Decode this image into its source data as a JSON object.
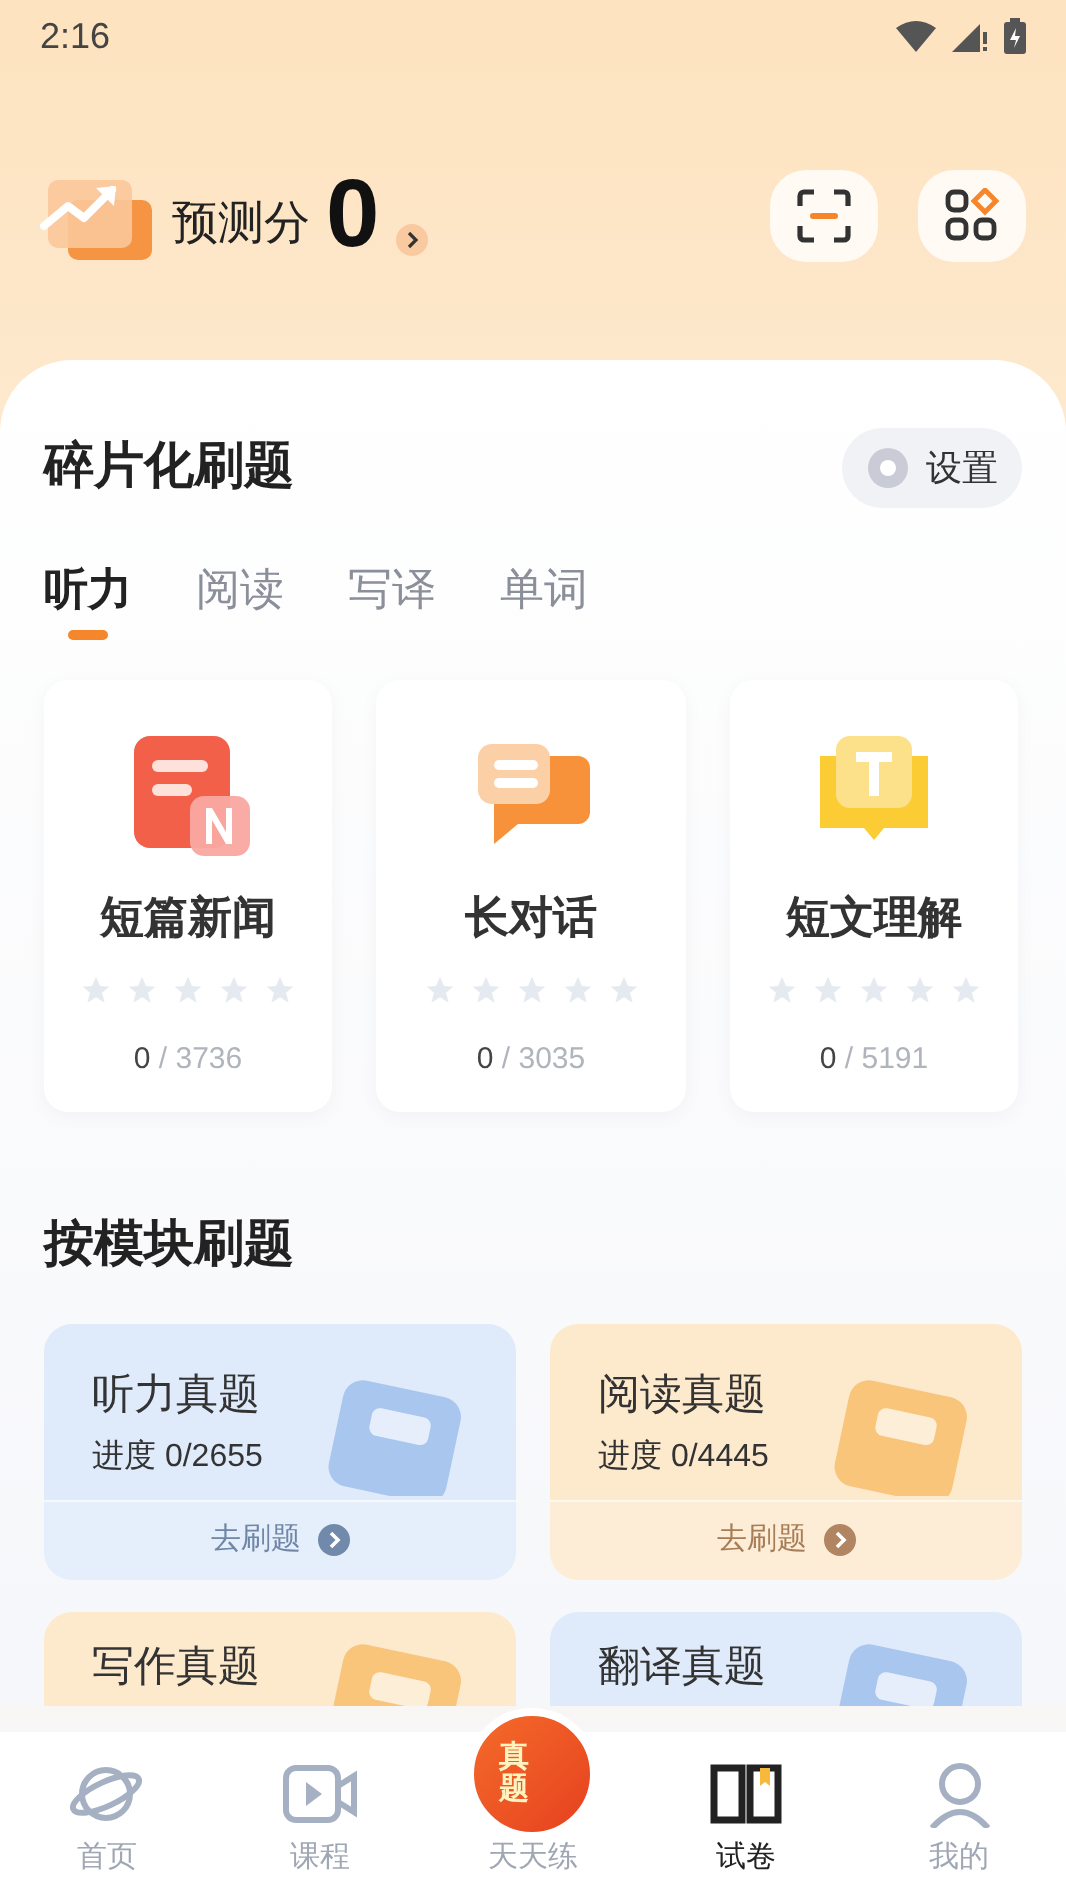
{
  "status_bar": {
    "time": "2:16"
  },
  "header": {
    "score_label": "预测分",
    "score": "0"
  },
  "fragment_section": {
    "title": "碎片化刷题",
    "settings_button": "设置",
    "tabs": [
      {
        "label": "听力",
        "selected": true
      },
      {
        "label": "阅读",
        "selected": false
      },
      {
        "label": "写译",
        "selected": false
      },
      {
        "label": "单词",
        "selected": false
      }
    ],
    "cards": [
      {
        "kind": "news",
        "title": "短篇新闻",
        "stars": 0,
        "done": "0",
        "total": "/ 3736"
      },
      {
        "kind": "dialog",
        "title": "长对话",
        "stars": 0,
        "done": "0",
        "total": "/ 3035"
      },
      {
        "kind": "passage",
        "title": "短文理解",
        "stars": 0,
        "done": "0",
        "total": "/ 5191"
      }
    ]
  },
  "module_section": {
    "title": "按模块刷题",
    "cards": [
      {
        "title": "听力真题",
        "progress": "进度 0/2655",
        "action": "去刷题",
        "color": "#dfeafb"
      },
      {
        "title": "阅读真题",
        "progress": "进度 0/4445",
        "action": "去刷题",
        "color": "#fde9cc"
      },
      {
        "title": "写作真题",
        "color": "#fde9cc"
      },
      {
        "title": "翻译真题",
        "color": "#dfeafb"
      }
    ]
  },
  "bottom_nav": [
    {
      "kind": "planet",
      "label": "首页",
      "selected": false
    },
    {
      "kind": "video",
      "label": "课程",
      "selected": false
    },
    {
      "kind": "center",
      "label": "天天练",
      "badge": "真题",
      "selected": false
    },
    {
      "kind": "book",
      "label": "试卷",
      "selected": true
    },
    {
      "kind": "person",
      "label": "我的",
      "selected": false
    }
  ]
}
